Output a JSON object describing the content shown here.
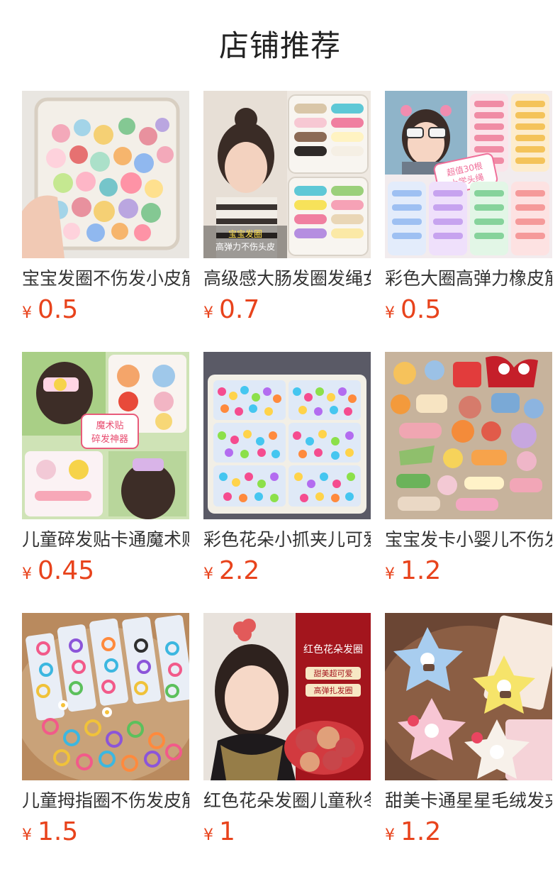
{
  "page": {
    "title": "店铺推荐"
  },
  "colors": {
    "price": "#e8431c",
    "title": "#222222",
    "name": "#333333"
  },
  "products": [
    {
      "name": "宝宝发圈不伤发小皮筋",
      "currency": "¥",
      "price": "0.5",
      "image_icon": "hair-ties-bag-image"
    },
    {
      "name": "高级感大肠发圈发绳女",
      "currency": "¥",
      "price": "0.7",
      "image_icon": "girl-hair-ties-box-image",
      "image_caption": [
        "宝宝发圈",
        "高弹力不伤头皮"
      ]
    },
    {
      "name": "彩色大圈高弹力橡皮筋",
      "currency": "¥",
      "price": "0.5",
      "image_icon": "girl-sunglasses-hair-ties-image",
      "image_caption": [
        "超值30根",
        "上学头绳"
      ]
    },
    {
      "name": "儿童碎发贴卡通魔术贴",
      "currency": "¥",
      "price": "0.45",
      "image_icon": "magic-hair-patch-image",
      "image_caption": [
        "魔术贴",
        "碎发神器"
      ]
    },
    {
      "name": "彩色花朵小抓夹儿可爱",
      "currency": "¥",
      "price": "2.2",
      "image_icon": "flower-claw-clips-image"
    },
    {
      "name": "宝宝发卡小婴儿不伤发",
      "currency": "¥",
      "price": "1.2",
      "image_icon": "baby-hair-clips-image"
    },
    {
      "name": "儿童拇指圈不伤发皮筋",
      "currency": "¥",
      "price": "1.5",
      "image_icon": "thumb-hair-rings-image"
    },
    {
      "name": "红色花朵发圈儿童秋冬",
      "currency": "¥",
      "price": "1",
      "image_icon": "red-flower-scrunchie-image",
      "image_caption": [
        "红色花朵发圈",
        "甜美超可爱",
        "高弹扎发圈"
      ]
    },
    {
      "name": "甜美卡通星星毛绒发夹",
      "currency": "¥",
      "price": "1.2",
      "image_icon": "star-plush-clips-image"
    }
  ]
}
